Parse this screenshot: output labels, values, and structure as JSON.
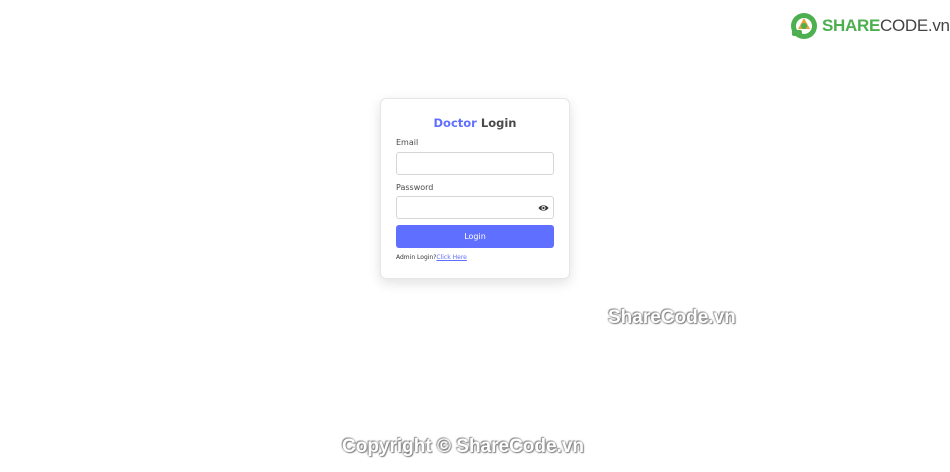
{
  "brand": {
    "logo_text_a": "SHARE",
    "logo_text_b": "CODE.vn",
    "logo_icon": "sharecode-logo-icon",
    "logo_color": "#4caf50"
  },
  "login_card": {
    "title_role": "Doctor",
    "title_suffix": "Login",
    "accent_color": "#5f6fff",
    "email_label": "Email",
    "email_value": "",
    "password_label": "Password",
    "password_value": "",
    "password_toggle_icon": "eye-icon",
    "submit_label": "Login",
    "switch_prompt": "Admin Login?",
    "switch_link": "Click Here"
  },
  "watermarks": {
    "middle": "ShareCode.vn",
    "bottom": "Copyright © ShareCode.vn"
  }
}
